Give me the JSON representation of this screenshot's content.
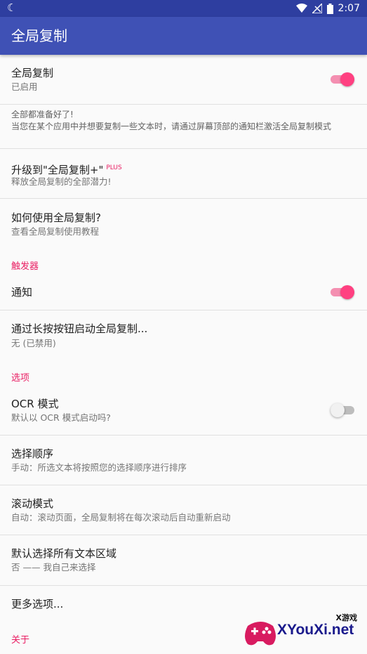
{
  "status_bar": {
    "time": "2:07",
    "icons": [
      "moon-icon",
      "wifi-icon",
      "signal-icon",
      "battery-icon"
    ]
  },
  "app_bar": {
    "title": "全局复制"
  },
  "main_toggle": {
    "title": "全局复制",
    "summary": "已启用",
    "enabled": true
  },
  "info": {
    "line1": "全部都准备好了!",
    "line2": "当您在某个应用中并想要复制一些文本时，请通过屏幕顶部的通知栏激活全局复制模式"
  },
  "upgrade": {
    "title": "升级到\"全局复制+\"",
    "badge": "PLUS",
    "summary": "释放全局复制的全部潜力!"
  },
  "howto": {
    "title": "如何使用全局复制?",
    "summary": "查看全局复制使用教程"
  },
  "triggers": {
    "header": "触发器",
    "notification": {
      "title": "通知",
      "enabled": true
    },
    "long_press": {
      "title": "通过长按按钮启动全局复制...",
      "summary": "无 (已禁用)"
    }
  },
  "options": {
    "header": "选项",
    "ocr": {
      "title": "OCR 模式",
      "summary": "默认以 OCR 模式启动吗?",
      "enabled": false
    },
    "order": {
      "title": "选择顺序",
      "summary": "手动：所选文本将按照您的选择顺序进行排序"
    },
    "scroll": {
      "title": "滚动模式",
      "summary": "自动：滚动页面，全局复制将在每次滚动后自动重新启动"
    },
    "select_all": {
      "title": "默认选择所有文本区域",
      "summary": "否 —— 我自己来选择"
    },
    "more": {
      "title": "更多选项..."
    }
  },
  "about": {
    "header": "关于"
  },
  "watermark": {
    "small": "X游戏",
    "big": "XYouXi.net"
  },
  "colors": {
    "primary": "#3f51b5",
    "primary_dark": "#2e3ea0",
    "accent": "#ff4081",
    "category": "#e91e63"
  }
}
